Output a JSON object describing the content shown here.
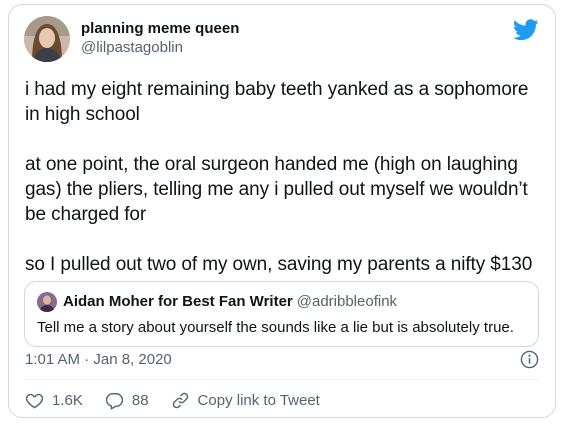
{
  "tweet": {
    "author": {
      "display_name": "planning meme queen",
      "handle": "@lilpastagoblin"
    },
    "paragraphs": [
      "i had my eight remaining baby teeth yanked as a sophomore in high school",
      "at one point, the oral surgeon handed me (high on laughing gas) the pliers, telling me any i pulled out myself we wouldn’t be charged for",
      "so I pulled out two of my own, saving my parents a nifty $130"
    ],
    "timestamp": "1:01 AM · Jan 8, 2020"
  },
  "quote": {
    "display_name": "Aidan Moher for Best Fan Writer",
    "handle": "@adribbleofink",
    "text": "Tell me a story about yourself the sounds like a lie but is absolutely true."
  },
  "actions": {
    "likes": "1.6K",
    "replies": "88",
    "share_label": "Copy link to Tweet"
  },
  "icons": {
    "logo": "twitter-bird-icon",
    "info": "info-icon",
    "like": "heart-icon",
    "reply": "reply-icon",
    "share": "link-icon"
  },
  "colors": {
    "twitter_blue": "#1d9bf0",
    "text_primary": "#0f1419",
    "text_secondary": "#536471",
    "border": "#cfd9de"
  }
}
